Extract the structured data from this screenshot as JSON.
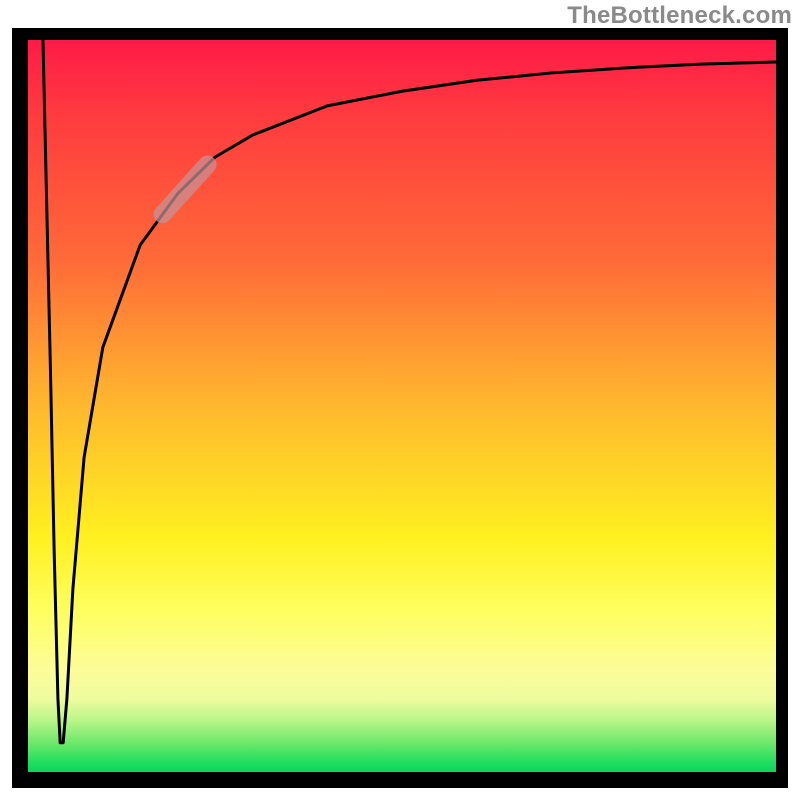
{
  "watermark": "TheBottleneck.com",
  "chart_data": {
    "type": "line",
    "title": "",
    "xlabel": "",
    "ylabel": "",
    "x_range": [
      0,
      100
    ],
    "y_range": [
      0,
      100
    ],
    "series": [
      {
        "name": "curve",
        "points": [
          {
            "x": 2.0,
            "y": 100.0
          },
          {
            "x": 3.0,
            "y": 55.0
          },
          {
            "x": 3.5,
            "y": 30.0
          },
          {
            "x": 4.0,
            "y": 10.0
          },
          {
            "x": 4.3,
            "y": 4.0
          },
          {
            "x": 4.7,
            "y": 4.0
          },
          {
            "x": 5.2,
            "y": 10.0
          },
          {
            "x": 6.0,
            "y": 25.0
          },
          {
            "x": 7.5,
            "y": 43.0
          },
          {
            "x": 10.0,
            "y": 58.0
          },
          {
            "x": 15.0,
            "y": 72.0
          },
          {
            "x": 20.0,
            "y": 79.0
          },
          {
            "x": 25.0,
            "y": 84.0
          },
          {
            "x": 30.0,
            "y": 87.0
          },
          {
            "x": 40.0,
            "y": 91.0
          },
          {
            "x": 50.0,
            "y": 93.0
          },
          {
            "x": 60.0,
            "y": 94.5
          },
          {
            "x": 70.0,
            "y": 95.5
          },
          {
            "x": 80.0,
            "y": 96.2
          },
          {
            "x": 90.0,
            "y": 96.7
          },
          {
            "x": 100.0,
            "y": 97.0
          }
        ]
      }
    ],
    "highlight_segment": {
      "x_from": 18.0,
      "x_to": 24.0
    },
    "colors": {
      "curve": "#000000",
      "highlight": "#c89196",
      "frame": "#000000",
      "gradient_stops": [
        "#ff1a48",
        "#ff3a3f",
        "#ff6a38",
        "#ffb82e",
        "#fff020",
        "#ffff60",
        "#fcfc9a",
        "#eefc9e",
        "#b8f68a",
        "#6ee86a",
        "#18dd5e",
        "#0fd45c"
      ]
    }
  }
}
